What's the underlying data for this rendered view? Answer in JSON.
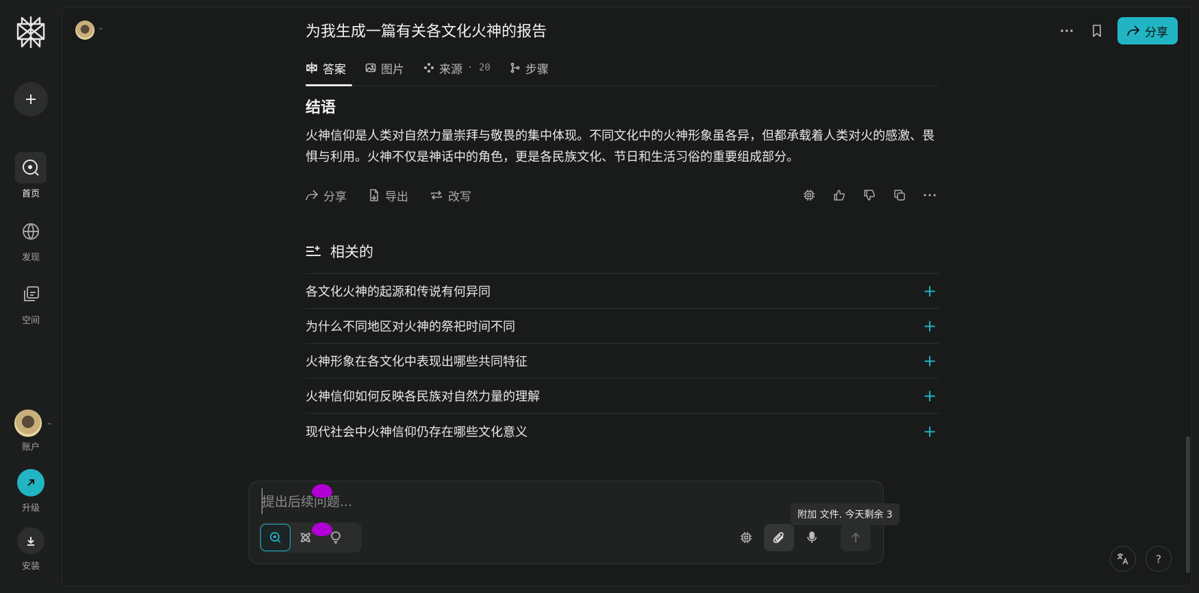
{
  "sidebar": {
    "nav": [
      {
        "label": "首页",
        "icon": "home-search-icon",
        "active": true
      },
      {
        "label": "发现",
        "icon": "discover-globe-icon",
        "active": false
      },
      {
        "label": "空间",
        "icon": "spaces-icon",
        "active": false
      }
    ],
    "account_label": "账户",
    "upgrade_label": "升级",
    "install_label": "安装"
  },
  "thread": {
    "title": "为我生成一篇有关各文化火神的报告",
    "tabs": [
      {
        "label": "答案",
        "icon": "answer-icon",
        "active": true
      },
      {
        "label": "图片",
        "icon": "image-icon",
        "active": false
      },
      {
        "label": "来源",
        "count": "· 20",
        "icon": "sources-icon",
        "active": false
      },
      {
        "label": "步骤",
        "icon": "steps-icon",
        "active": false
      }
    ],
    "share_label": "分享"
  },
  "answer": {
    "heading": "结语",
    "paragraph": "火神信仰是人类对自然力量崇拜与敬畏的集中体现。不同文化中的火神形象虽各异，但都承载着人类对火的感激、畏惧与利用。火神不仅是神话中的角色，更是各民族文化、节日和生活习俗的重要组成部分。",
    "actions": {
      "share": "分享",
      "export": "导出",
      "rewrite": "改写"
    }
  },
  "related": {
    "title": "相关的",
    "items": [
      "各文化火神的起源和传说有何异同",
      "为什么不同地区对火神的祭祀时间不同",
      "火神形象在各文化中表现出哪些共同特征",
      "火神信仰如何反映各民族对自然力量的理解",
      "现代社会中火神信仰仍存在哪些文化意义"
    ]
  },
  "composer": {
    "placeholder": "提出后续问题...",
    "tooltip": "附加 文件. 今天剩余 3"
  },
  "colors": {
    "accent": "#21b5c4",
    "background": "#191a1a",
    "marker": "#b100d4"
  }
}
